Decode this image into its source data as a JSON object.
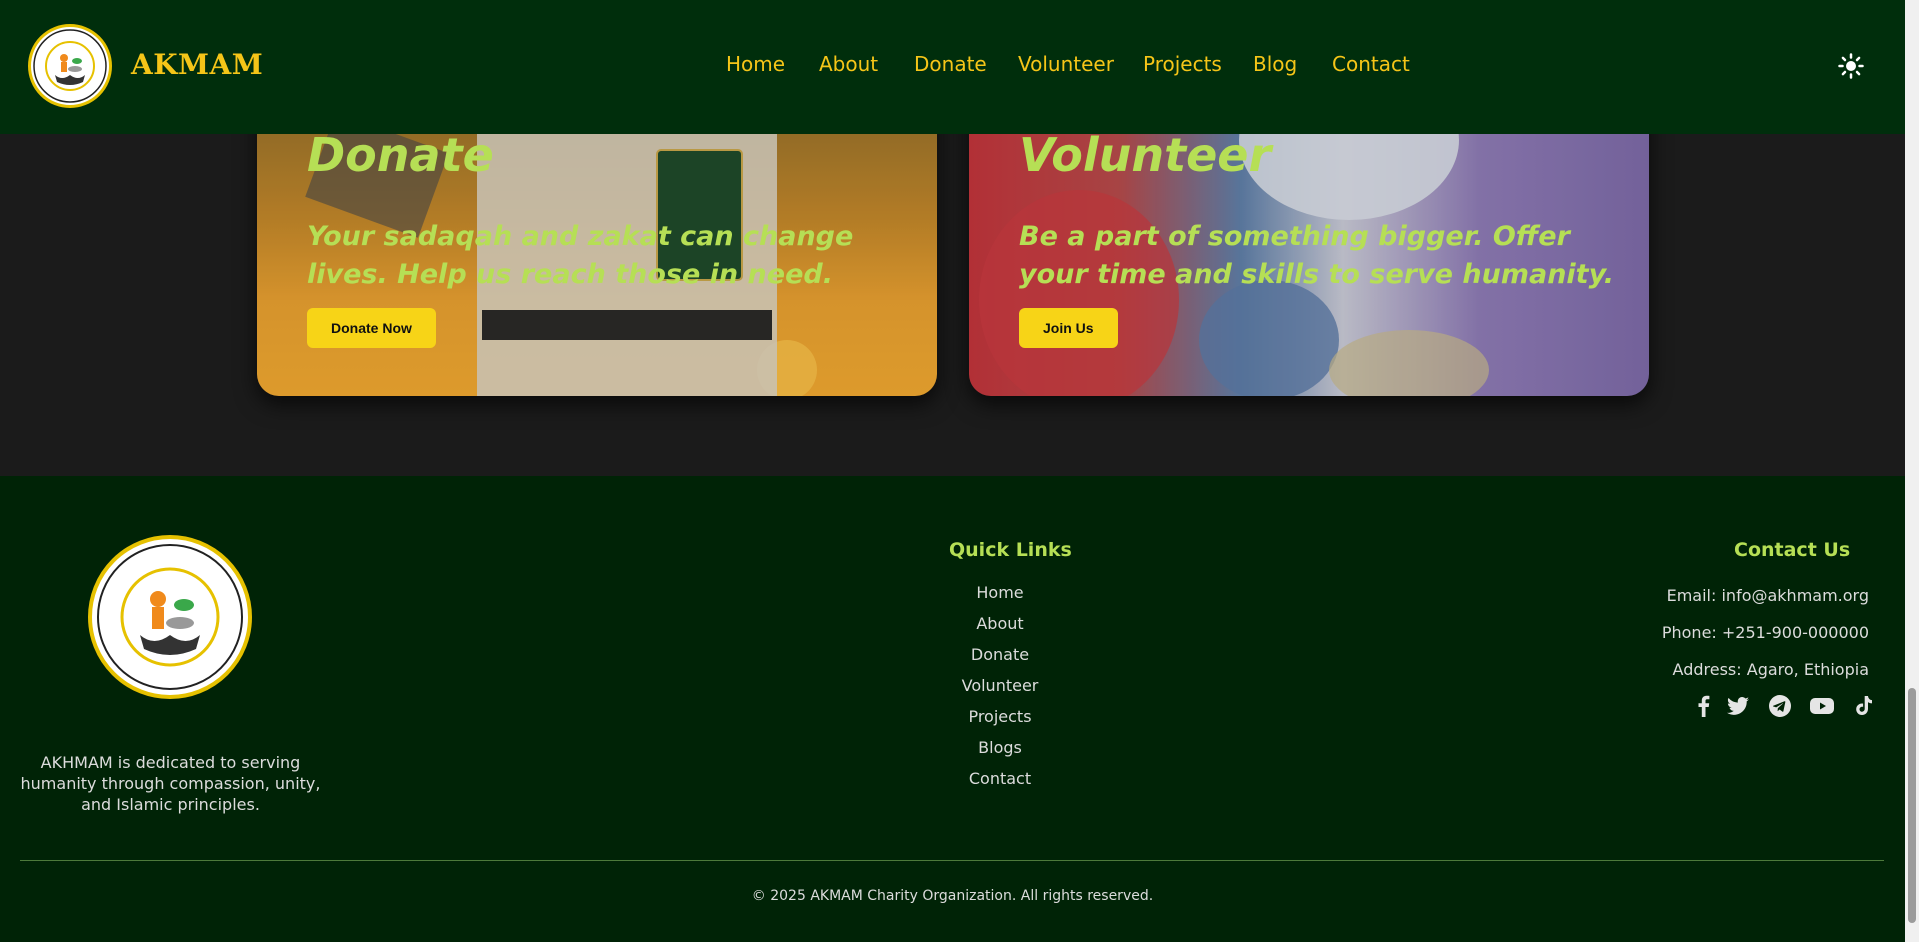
{
  "header": {
    "brand": "AKMAM",
    "nav": [
      "Home",
      "About",
      "Donate",
      "Volunteer",
      "Projects",
      "Blog",
      "Contact"
    ]
  },
  "cards": {
    "donate": {
      "title": "Donate",
      "text": "Your sadaqah and zakat can change lives. Help us reach those in need.",
      "button": "Donate Now"
    },
    "volunteer": {
      "title": "Volunteer",
      "text": "Be a part of something bigger. Offer your time and skills to serve humanity.",
      "button": "Join Us"
    }
  },
  "footer": {
    "about": "AKHMAM is dedicated to serving humanity through compassion, unity, and Islamic principles.",
    "quick_links_title": "Quick Links",
    "quick_links": [
      "Home",
      "About",
      "Donate",
      "Volunteer",
      "Projects",
      "Blogs",
      "Contact"
    ],
    "contact_title": "Contact Us",
    "email": "Email: info@akhmam.org",
    "phone": "Phone: +251-900-000000",
    "address": "Address: Agaro, Ethiopia",
    "socials": [
      "facebook-icon",
      "twitter-icon",
      "telegram-icon",
      "youtube-icon",
      "tiktok-icon"
    ],
    "copyright": "© 2025 AKMAM Charity Organization. All rights reserved."
  },
  "colors": {
    "header_bg": "#002e0c",
    "footer_bg": "#002306",
    "accent_yellow": "#f5c518",
    "accent_green": "#b6df55",
    "button_yellow": "#f7d417",
    "section_bg": "#1b1b1b"
  }
}
